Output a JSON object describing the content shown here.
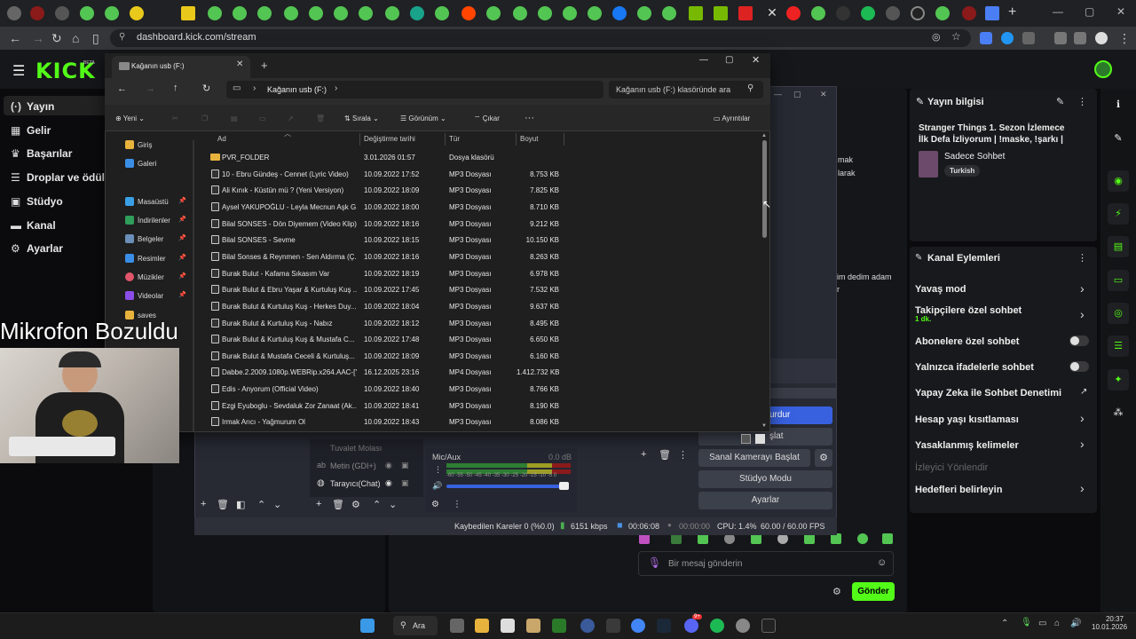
{
  "browser": {
    "tab_close": "✕",
    "new_tab": "+",
    "url": "dashboard.kick.com/stream"
  },
  "kick": {
    "logo": "KICK",
    "beta": "BETA",
    "nav": [
      "Yayın",
      "Gelir",
      "Başarılar",
      "Droplar ve ödüller",
      "Stüdyo",
      "Kanal",
      "Ayarlar"
    ],
    "stream_info": {
      "title": "Yayın bilgisi",
      "stream_title": "Stranger Things 1. Sezon İzlemece İlk Defa İzliyorum | !maske, !şarkı |",
      "category": "Sadece Sohbet",
      "language": "Turkish"
    },
    "channel_actions": {
      "title": "Kanal Eylemleri",
      "items": [
        {
          "label": "Yavaş mod",
          "type": "chevron"
        },
        {
          "label": "Takipçilere özel sohbet",
          "sub": "1 dk.",
          "type": "chevron"
        },
        {
          "label": "Abonelere özel sohbet",
          "type": "toggle"
        },
        {
          "label": "Yalnızca ifadelerle sohbet",
          "type": "toggle"
        },
        {
          "label": "Yapay Zeka ile Sohbet Denetimi",
          "type": "link"
        },
        {
          "label": "Hesap yaşı kısıtlaması",
          "type": "chevron"
        },
        {
          "label": "Yasaklanmış kelimeler",
          "type": "chevron"
        },
        {
          "label": "İzleyici Yönlendir",
          "type": "disabled"
        },
        {
          "label": "Hedefleri belirleyin",
          "type": "chevron"
        }
      ]
    },
    "chat_snippets": [
      "mak",
      "larak",
      "im dedim adam",
      "r"
    ],
    "chat_placeholder": "Bir mesaj gönderin",
    "send_label": "Gönder"
  },
  "obs": {
    "buttons": [
      "urdur",
      "şlat",
      "Sanal Kamerayı Başlat",
      "Stüdyo Modu",
      "Ayarlar"
    ],
    "sources": [
      "Tuvalet Molası",
      "Metin (GDI+)",
      "Tarayıcı(Chat)"
    ],
    "mixer_label": "Mic/Aux",
    "mixer_db": "0.0 dB",
    "meter_ticks": "-60 -55 -50 -45 -40 -35 -30 -25 -20 -15 -10 -5 0",
    "status": {
      "dropped": "Kaybedilen Kareler 0 (%0.0)",
      "bitrate": "6151 kbps",
      "rec_time": "00:06:08",
      "idle_time": "00:00:00",
      "cpu": "CPU: 1.4%",
      "fps": "60.00 / 60.00 FPS"
    }
  },
  "explorer": {
    "tab_title": "Kağanın usb (F:)",
    "breadcrumb": "Kağanın usb (F:)",
    "search_placeholder": "Kağanın usb (F:) klasöründe ara",
    "commands": {
      "new": "Yeni",
      "sort": "Sırala",
      "view": "Görünüm",
      "extract": "Çıkar",
      "more": "···",
      "details": "Ayrıntılar"
    },
    "sidebar": [
      "Giriş",
      "Galeri",
      "Masaüstü",
      "İndirilenler",
      "Belgeler",
      "Resimler",
      "Müzikler",
      "Videolar",
      "saves"
    ],
    "columns": {
      "name": "Ad",
      "date": "Değiştirme tarihi",
      "type": "Tür",
      "size": "Boyut"
    },
    "files": [
      {
        "name": "PVR_FOLDER",
        "date": "3.01.2026 01:57",
        "type": "Dosya klasörü",
        "size": "",
        "folder": true
      },
      {
        "name": "10 - Ebru Gündeş - Cennet (Lyric Video)",
        "date": "10.09.2022 17:52",
        "type": "MP3 Dosyası",
        "size": "8.753 KB"
      },
      {
        "name": "Ali Kınık - Küstün mü ?  (Yeni Versiyon)",
        "date": "10.09.2022 18:09",
        "type": "MP3 Dosyası",
        "size": "7.825 KB"
      },
      {
        "name": "Aysel YAKUPOĞLU - Leyla Mecnun Aşk G...",
        "date": "10.09.2022 18:00",
        "type": "MP3 Dosyası",
        "size": "8.710 KB"
      },
      {
        "name": "Bilal SONSES - Dön Diyemem (Video Klip)",
        "date": "10.09.2022 18:16",
        "type": "MP3 Dosyası",
        "size": "9.212 KB"
      },
      {
        "name": "Bilal SONSES - Sevme",
        "date": "10.09.2022 18:15",
        "type": "MP3 Dosyası",
        "size": "10.150 KB"
      },
      {
        "name": "Bilal Sonses & Reynmen - Sen Aldırma (Ç...",
        "date": "10.09.2022 18:16",
        "type": "MP3 Dosyası",
        "size": "8.263 KB"
      },
      {
        "name": "Burak Bulut - Kafama Sıkasım Var",
        "date": "10.09.2022 18:19",
        "type": "MP3 Dosyası",
        "size": "6.978 KB"
      },
      {
        "name": "Burak Bulut & Ebru Yaşar & Kurtuluş Kuş ...",
        "date": "10.09.2022 17:45",
        "type": "MP3 Dosyası",
        "size": "7.532 KB"
      },
      {
        "name": "Burak Bulut & Kurtuluş Kuş - Herkes Duy...",
        "date": "10.09.2022 18:04",
        "type": "MP3 Dosyası",
        "size": "9.637 KB"
      },
      {
        "name": "Burak Bulut & Kurtuluş Kuş - Nabız",
        "date": "10.09.2022 18:12",
        "type": "MP3 Dosyası",
        "size": "8.495 KB"
      },
      {
        "name": "Burak Bulut & Kurtuluş Kuş & Mustafa C...",
        "date": "10.09.2022 17:48",
        "type": "MP3 Dosyası",
        "size": "6.650 KB"
      },
      {
        "name": "Burak Bulut & Mustafa Ceceli & Kurtuluş...",
        "date": "10.09.2022 18:09",
        "type": "MP3 Dosyası",
        "size": "6.160 KB"
      },
      {
        "name": "Dabbe.2.2009.1080p.WEBRip.x264.AAC-[Y...",
        "date": "16.12.2025 23:16",
        "type": "MP4 Dosyası",
        "size": "1.412.732 KB"
      },
      {
        "name": "Edis - Anyorum (Official Video)",
        "date": "10.09.2022 18:40",
        "type": "MP3 Dosyası",
        "size": "8.766 KB"
      },
      {
        "name": "Ezgi Eyuboglu - Sevdaluk Zor Zanaat (Ak...",
        "date": "10.09.2022 18:41",
        "type": "MP3 Dosyası",
        "size": "8.190 KB"
      },
      {
        "name": "Irmak Arıcı - Yağmurum Ol",
        "date": "10.09.2022 18:43",
        "type": "MP3 Dosyası",
        "size": "8.086 KB"
      }
    ]
  },
  "overlay": {
    "cam_title": "Mikrofon Bozuldu"
  },
  "taskbar": {
    "search": "Ara",
    "time": "20:37",
    "date": "10.01.2026",
    "discord_badge": "9+"
  }
}
